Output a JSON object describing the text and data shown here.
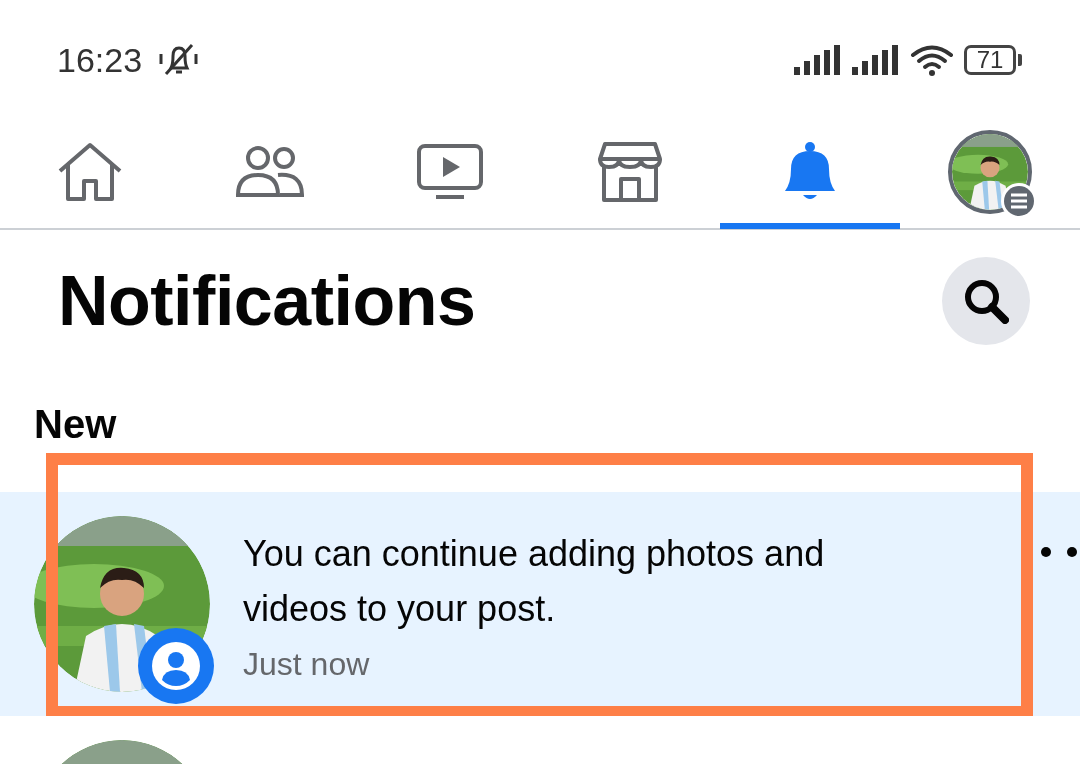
{
  "status_bar": {
    "time": "16:23",
    "battery": "71"
  },
  "tabs": [
    {
      "selected": false
    },
    {
      "selected": false
    },
    {
      "selected": false
    },
    {
      "selected": false
    },
    {
      "selected": true
    },
    {
      "selected": false
    }
  ],
  "header": {
    "title": "Notifications"
  },
  "section": {
    "title": "New"
  },
  "notifications": [
    {
      "text": "You can continue adding photos and videos to your post.",
      "time": "Just now",
      "unread": true,
      "highlighted": true
    },
    {
      "unread": false,
      "highlighted": false
    }
  ]
}
